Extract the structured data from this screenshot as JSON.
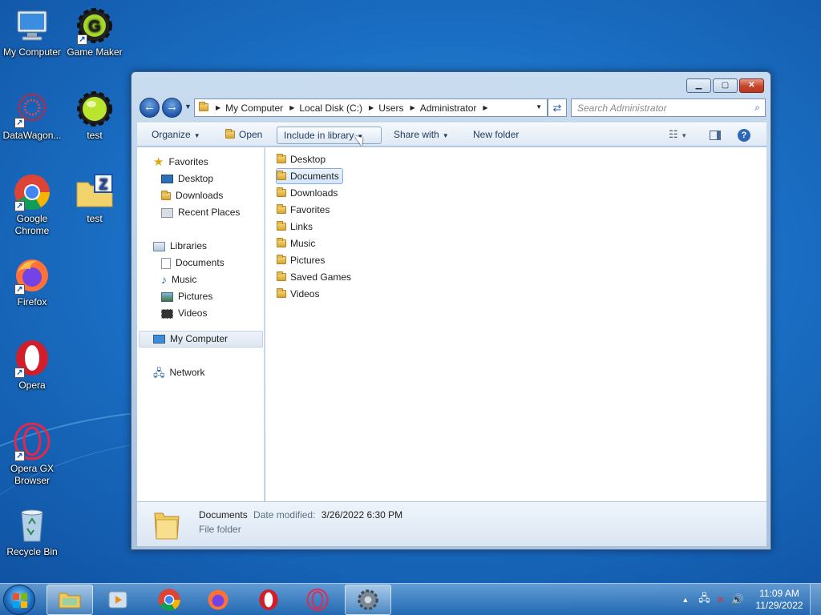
{
  "desktop": {
    "icons": [
      {
        "label": "My Computer"
      },
      {
        "label": "Game Maker"
      },
      {
        "label": "DataWagon..."
      },
      {
        "label": "test"
      },
      {
        "label": "Google Chrome"
      },
      {
        "label": "test"
      },
      {
        "label": "Firefox"
      },
      {
        "label": "Opera"
      },
      {
        "label": "Opera GX Browser"
      },
      {
        "label": "Recycle Bin"
      }
    ]
  },
  "window": {
    "address": [
      "My Computer",
      "Local Disk (C:)",
      "Users",
      "Administrator"
    ],
    "search_placeholder": "Search Administrator",
    "toolbar": {
      "organize": "Organize",
      "open": "Open",
      "include": "Include in library",
      "share": "Share with",
      "new_folder": "New folder"
    },
    "nav": {
      "favorites": "Favorites",
      "fav_items": [
        "Desktop",
        "Downloads",
        "Recent Places"
      ],
      "libraries": "Libraries",
      "lib_items": [
        "Documents",
        "Music",
        "Pictures",
        "Videos"
      ],
      "computer": "My Computer",
      "network": "Network"
    },
    "files": [
      "Desktop",
      "Documents",
      "Downloads",
      "Favorites",
      "Links",
      "Music",
      "Pictures",
      "Saved Games",
      "Videos"
    ],
    "selected_file": "Documents",
    "details": {
      "name": "Documents",
      "modified_label": "Date modified:",
      "modified_value": "3/26/2022 6:30 PM",
      "type": "File folder"
    }
  },
  "taskbar": {
    "time": "11:09 AM",
    "date": "11/29/2022"
  }
}
